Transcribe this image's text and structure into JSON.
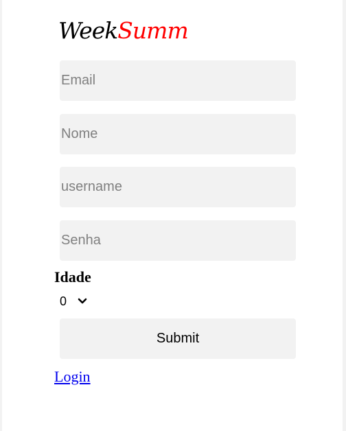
{
  "logo": {
    "part1": "Week",
    "part2": "Summ"
  },
  "form": {
    "email": {
      "placeholder": "Email",
      "value": ""
    },
    "nome": {
      "placeholder": "Nome",
      "value": ""
    },
    "username": {
      "placeholder": "username",
      "value": ""
    },
    "senha": {
      "placeholder": "Senha",
      "value": ""
    },
    "idade_label": "Idade",
    "idade_value": "0",
    "submit_label": "Submit"
  },
  "login_link": "Login",
  "colors": {
    "logo_accent": "#ff0000",
    "field_bg": "#f2f2f2",
    "link": "#0000ee"
  },
  "icons": {
    "select_chevron": "chevron-down-icon"
  }
}
